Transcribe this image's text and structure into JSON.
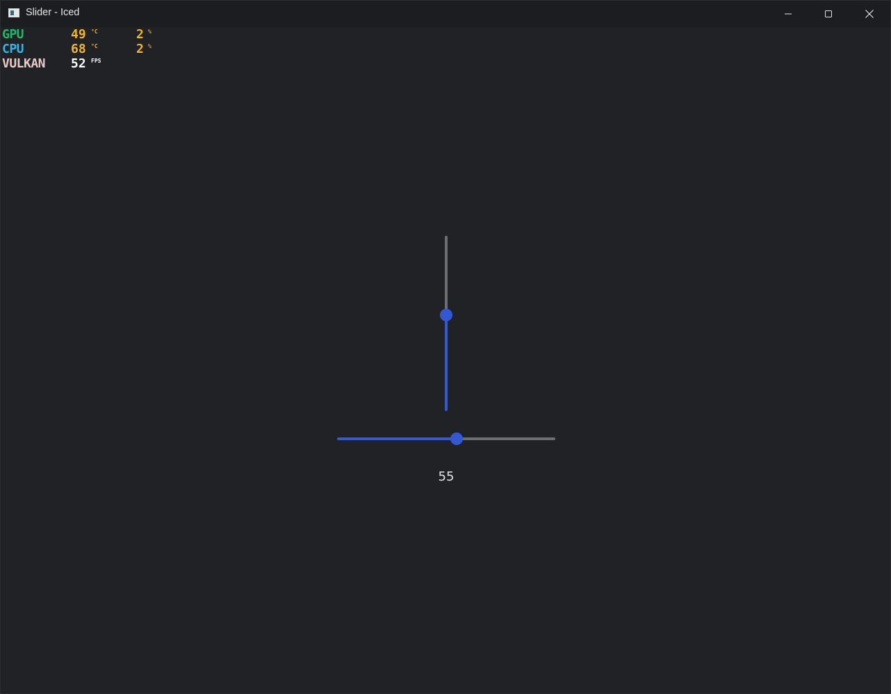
{
  "window": {
    "title": "Slider - Iced",
    "icon": "app-window-icon",
    "buttons": {
      "minimize": "minimize-icon",
      "maximize": "maximize-icon",
      "close": "close-icon"
    }
  },
  "overlay": {
    "rows": [
      {
        "label": "GPU",
        "label_color": "#1fb86a",
        "temp": "49",
        "temp_unit": "°C",
        "load": "2",
        "load_unit": "%"
      },
      {
        "label": "CPU",
        "label_color": "#2fb6e8",
        "temp": "68",
        "temp_unit": "°C",
        "load": "2",
        "load_unit": "%"
      },
      {
        "label": "VULKAN",
        "label_color": "#e8c9c9",
        "fps": "52",
        "fps_unit": "FPS"
      }
    ],
    "value_color": "#f2b52a",
    "fps_color": "#ffffff"
  },
  "slider": {
    "value": 55,
    "min": 0,
    "max": 100,
    "value_label": "55",
    "active_color": "#3358d4",
    "inactive_color": "#6e6e72"
  },
  "colors": {
    "background": "#212226",
    "titlebar": "#1c1d20",
    "text": "#e4e4e4"
  }
}
